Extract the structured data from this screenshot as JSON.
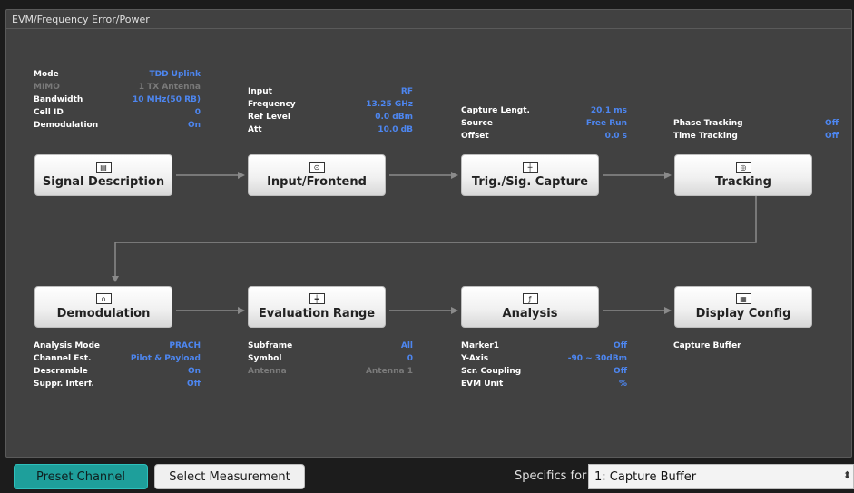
{
  "panel": {
    "title": "EVM/Frequency Error/Power"
  },
  "signal_description": {
    "rows": [
      {
        "k": "Mode",
        "v": "TDD Uplink",
        "dim": false
      },
      {
        "k": "MIMO",
        "v": "1 TX Antenna",
        "dim": true
      },
      {
        "k": "Bandwidth",
        "v": "10 MHz(50 RB)",
        "dim": false
      },
      {
        "k": "Cell ID",
        "v": "0",
        "dim": false
      },
      {
        "k": "Demodulation",
        "v": "On",
        "dim": false
      }
    ]
  },
  "input_frontend": {
    "rows": [
      {
        "k": "Input",
        "v": "RF"
      },
      {
        "k": "Frequency",
        "v": "13.25 GHz"
      },
      {
        "k": "Ref Level",
        "v": "0.0 dBm"
      },
      {
        "k": "Att",
        "v": "10.0 dB"
      }
    ]
  },
  "capture": {
    "rows": [
      {
        "k": "Capture Lengt.",
        "v": "20.1 ms"
      },
      {
        "k": "Source",
        "v": "Free Run"
      },
      {
        "k": "Offset",
        "v": "0.0 s"
      }
    ]
  },
  "tracking": {
    "rows": [
      {
        "k": "Phase Tracking",
        "v": "Off"
      },
      {
        "k": "Time Tracking",
        "v": "Off"
      }
    ]
  },
  "demod": {
    "rows": [
      {
        "k": "Analysis Mode",
        "v": "PRACH",
        "dim": false
      },
      {
        "k": "Channel Est.",
        "v": "Pilot & Payload",
        "dim": false
      },
      {
        "k": "Descramble",
        "v": "On",
        "dim": false
      },
      {
        "k": "Suppr. Interf.",
        "v": "Off",
        "dim": false
      }
    ]
  },
  "evalrange": {
    "rows": [
      {
        "k": "Subframe",
        "v": "All",
        "dim": false
      },
      {
        "k": "Symbol",
        "v": "0",
        "dim": false
      },
      {
        "k": "Antenna",
        "v": "Antenna 1",
        "dim": true
      }
    ]
  },
  "analysis": {
    "rows": [
      {
        "k": "Marker1",
        "v": "Off"
      },
      {
        "k": "Y-Axis",
        "v": "-90 ~ 30dBm"
      },
      {
        "k": "Scr. Coupling",
        "v": "Off"
      },
      {
        "k": "EVM Unit",
        "v": "%"
      }
    ]
  },
  "display_config": {
    "rows": [
      {
        "k": "Capture Buffer",
        "v": ""
      }
    ]
  },
  "blocks": {
    "signal_description": "Signal Description",
    "input_frontend": "Input/Frontend",
    "trig_capture": "Trig./Sig. Capture",
    "tracking": "Tracking",
    "demodulation": "Demodulation",
    "evaluation_range": "Evaluation Range",
    "analysis": "Analysis",
    "display_config": "Display Config"
  },
  "icons": {
    "signal_description": "signal-description-icon",
    "input_frontend": "input-icon",
    "trig_capture": "trigger-icon",
    "tracking": "tracking-icon",
    "demodulation": "demodulation-icon",
    "evaluation_range": "evaluation-range-icon",
    "analysis": "analysis-icon",
    "display_config": "display-config-icon"
  },
  "footer": {
    "preset_label": "Preset Channel",
    "select_label": "Select Measurement",
    "specifics_label": "Specifics for",
    "specifics_value": "1: Capture Buffer"
  },
  "colors": {
    "value_blue": "#4d86f0",
    "preset_teal": "#1e9f9b",
    "panel_bg": "#414141"
  }
}
